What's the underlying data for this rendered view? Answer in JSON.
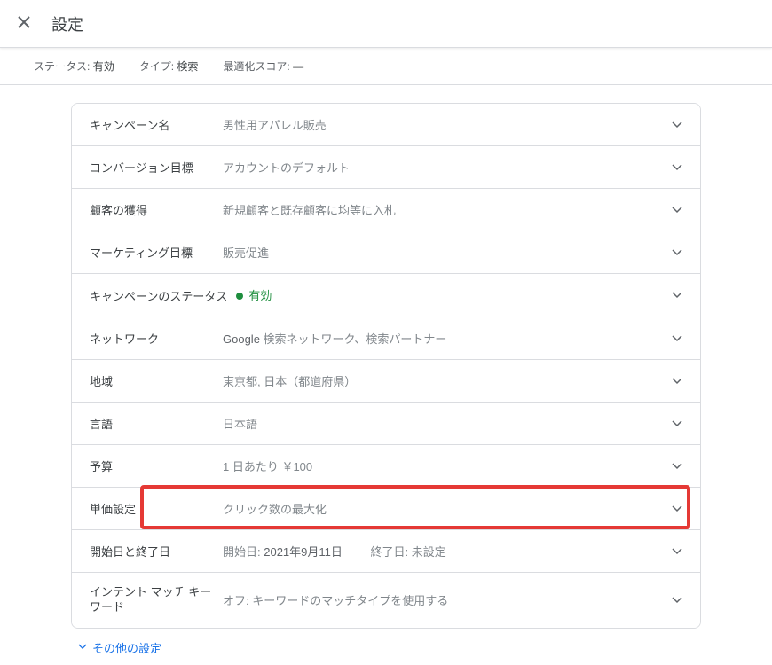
{
  "header": {
    "title": "設定"
  },
  "statusBar": {
    "status_label": "ステータス:",
    "status_value": "有効",
    "type_label": "タイプ:",
    "type_value": "検索",
    "opt_label": "最適化スコア:",
    "opt_value": "—"
  },
  "rows": {
    "campaignName": {
      "label": "キャンペーン名",
      "value": "男性用アパレル販売"
    },
    "conversionGoal": {
      "label": "コンバージョン目標",
      "value": "アカウントのデフォルト"
    },
    "customerAcq": {
      "label": "顧客の獲得",
      "value": "新規顧客と既存顧客に均等に入札"
    },
    "marketingGoal": {
      "label": "マーケティング目標",
      "value": "販売促進"
    },
    "campaignStatus": {
      "label": "キャンペーンのステータス",
      "value": "有効"
    },
    "networks": {
      "label": "ネットワーク",
      "prefix": "Google",
      "value": " 検索ネットワーク、検索パートナー"
    },
    "locations": {
      "label": "地域",
      "value": "東京都, 日本（都道府県）"
    },
    "languages": {
      "label": "言語",
      "value": "日本語"
    },
    "budget": {
      "label": "予算",
      "value": "1 日あたり ￥100"
    },
    "bidding": {
      "label": "単価設定",
      "value": "クリック数の最大化"
    },
    "dates": {
      "label": "開始日と終了日",
      "start_label": "開始日:",
      "start_value": " 2021年9月11日",
      "end_label": "終了日:",
      "end_value": " 未設定"
    },
    "intentMatch": {
      "label": "インテント マッチ キーワード",
      "value": "オフ: キーワードのマッチタイプを使用する"
    }
  },
  "moreSettings": "その他の設定"
}
